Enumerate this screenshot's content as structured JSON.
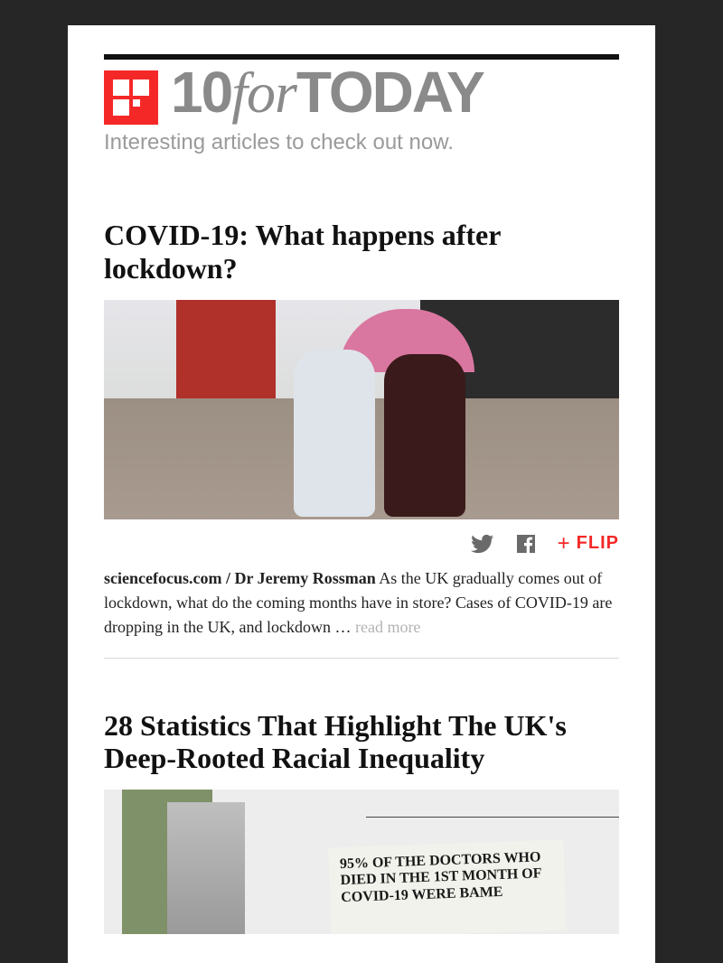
{
  "brand": {
    "ten": "10",
    "for": "for",
    "today": "TODAY",
    "tagline": "Interesting articles to check out now."
  },
  "actions": {
    "flip_label": "FLIP",
    "plus": "+"
  },
  "articles": [
    {
      "headline": "COVID-19: What happens after lockdown?",
      "source": "sciencefocus.com / Dr Jeremy Rossman",
      "summary": "As the UK gradually comes out of lockdown, what do the coming months have in store? Cases of COVID-19 are dropping in the UK, and lockdown …",
      "read_more": "read more"
    },
    {
      "headline": "28 Statistics That Highlight The UK's Deep-Rooted Racial Inequality",
      "sign_text": "95% OF THE DOCTORS WHO DIED IN THE 1ST MONTH OF COVID-19 WERE BAME"
    }
  ]
}
